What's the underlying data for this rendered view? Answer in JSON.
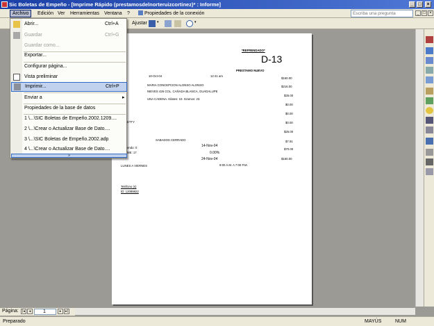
{
  "window": {
    "title": "Sic Boletas de Empeño - [Imprime Rápido (prestamosdelnorteruizcortinez)* : Informe]"
  },
  "menubar": {
    "items": [
      "Archivo",
      "Edición",
      "Ver",
      "Herramientas",
      "Ventana",
      "?"
    ],
    "extra": "Propiedades de la conexión",
    "help_placeholder": "Escriba una pregunta"
  },
  "toolbar": {
    "ajustar_label": "Ajustar"
  },
  "file_menu": {
    "items": [
      {
        "label": "Abrir...",
        "shortcut": "Ctrl+A"
      },
      {
        "label": "Guardar",
        "shortcut": "Ctrl+G"
      },
      {
        "label": "Guardar como..."
      },
      {
        "label": "Exportar..."
      },
      {
        "label": "Configurar página..."
      },
      {
        "label": "Vista preliminar"
      },
      {
        "label": "Imprimir...",
        "shortcut": "Ctrl+P"
      },
      {
        "label": "Enviar a"
      },
      {
        "label": "Propiedades de la base de datos"
      },
      {
        "label": "1 \\...\\SIC Boletas de Empeño.2002.1209...."
      },
      {
        "label": "2 \\...\\Crear o Actualizar Base de Dato...."
      },
      {
        "label": "3 \\...\\SIC Boletas de Empeño.2002.adp"
      },
      {
        "label": "4 \\...\\Crear o Actualizar Base de Dato...."
      }
    ]
  },
  "report": {
    "heading": "*REFRENDADO*",
    "number": "D-13",
    "loan_label": "PRESTAMO NUEVO",
    "date": "10-Oct-04",
    "time": "12:41 am",
    "customer": "MARIA CONCEPCION ALONSO ALONSO",
    "address": "NIEVES 426 COL. CAÑADA BLANCA, GUADALUPE",
    "item": "UNA CADENA. Kilates: 10. Gramos: 23.",
    "amounts": [
      "$160.00",
      "$216.00",
      "$25.00",
      "$0.00",
      "$0.00",
      "$0.00",
      "$25.00",
      "$7.91",
      "$70.00",
      "$160.00"
    ],
    "etty": "ETTY",
    "saturday": "SABADOS CERRADO",
    "row1_left": "endo: 0",
    "row1_date": "14-Nov-04",
    "row2_left": "ME: 17",
    "row2_pct": "0.00%",
    "row3_date": "24-Nov-04",
    "schedule": "LUNES A VIERNES",
    "hours": "9:00 A.M. A 7:00 P.M.",
    "phone": "Teléfono (s)",
    "id": "ID: 12089822"
  },
  "nav": {
    "label": "Página:",
    "page": "1"
  },
  "status": {
    "left": "Preparado",
    "mayus": "MAYÚS",
    "num": "NUM"
  }
}
